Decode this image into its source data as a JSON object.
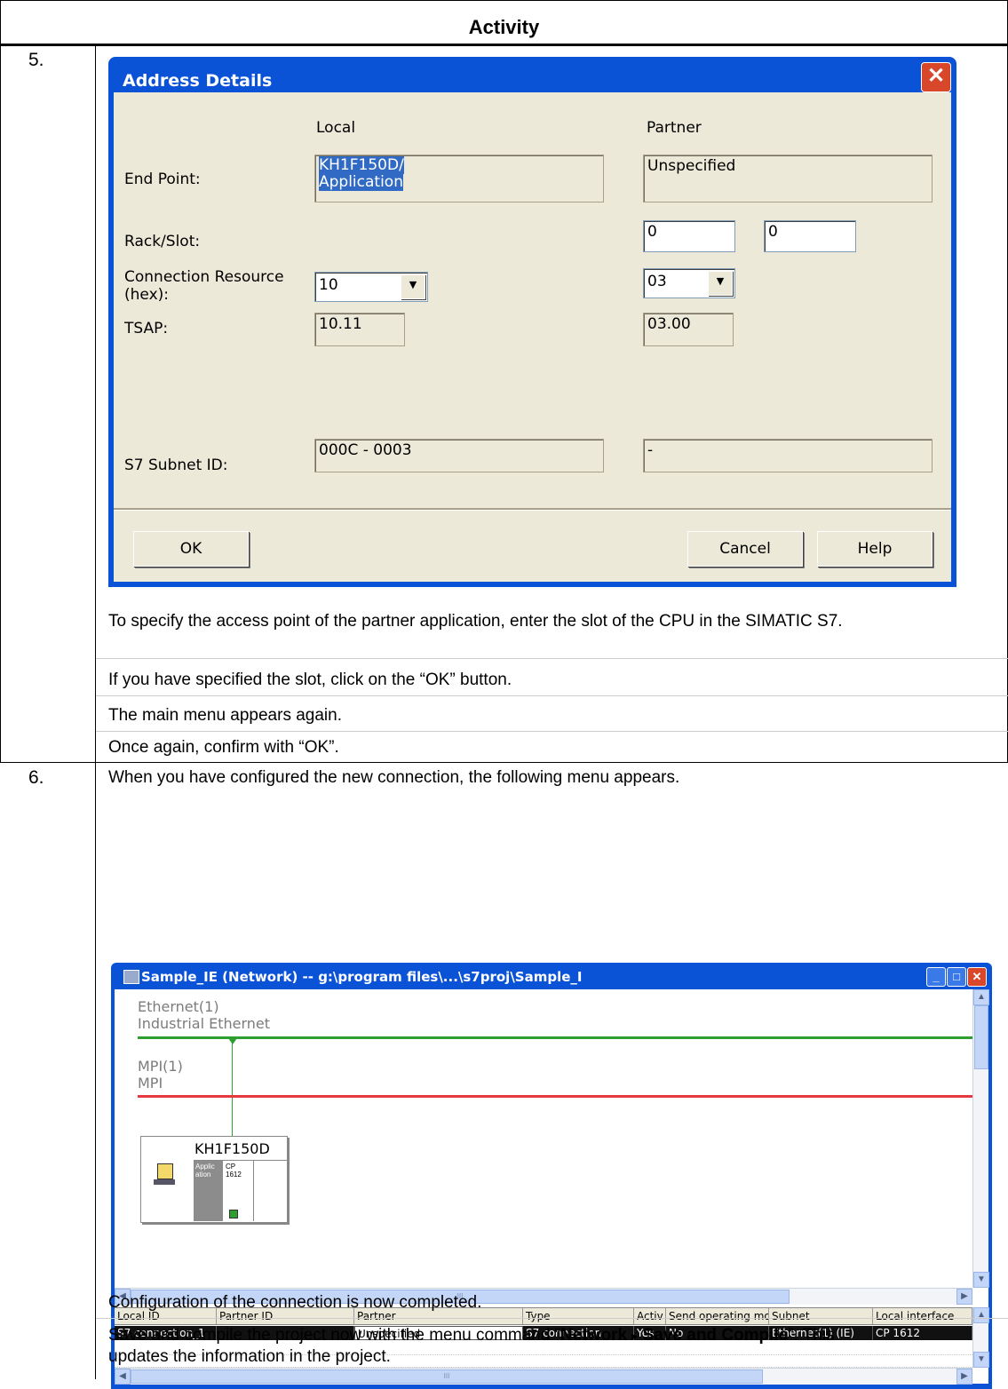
{
  "table": {
    "header": "Activity",
    "steps": [
      {
        "number": "5.",
        "paragraphs": [
          "To specify the access point of the partner application, enter the slot of the CPU in the SIMATIC S7.",
          "If you have specified the slot, click on the “OK” button.",
          "The main menu appears again.",
          "Once again, confirm with “OK”."
        ]
      },
      {
        "number": "6.",
        "intro": "When you have configured the new connection, the following menu appears.",
        "outro1": "Configuration of the connection is now completed.",
        "outro2_prefix": "Save and compile the project now with the menu command “",
        "outro2_bold1": "Network",
        "outro2_arrow": "▸",
        "outro2_bold2": "Save and Compile",
        "outro2_suffix": "”. This updates the information in the project."
      }
    ]
  },
  "dialog": {
    "title": "Address Details",
    "close_icon": "close-icon",
    "col_local": "Local",
    "col_partner": "Partner",
    "end_point_label": "End Point:",
    "end_point_local_line1": "KH1F150D/",
    "end_point_local_line2": "Application",
    "end_point_partner": "Unspecified",
    "rack_slot_label": "Rack/Slot:",
    "rack_value": "0",
    "slot_value": "0",
    "conn_res_label_line1": "Connection Resource",
    "conn_res_label_line2": "(hex):",
    "conn_res_local": "10",
    "conn_res_partner": "03",
    "tsap_label": "TSAP:",
    "tsap_local": "10.11",
    "tsap_partner": "03.00",
    "subnet_label": "S7 Subnet ID:",
    "subnet_local": "000C - 0003",
    "subnet_partner": "-",
    "ok_label": "OK",
    "cancel_label": "Cancel",
    "help_label": "Help"
  },
  "netwindow": {
    "title": "Sample_IE (Network) -- g:\\program files\\...\\s7proj\\Sample_I",
    "ethernet_name": "Ethernet(1)",
    "ethernet_type": "Industrial Ethernet",
    "mpi_name": "MPI(1)",
    "mpi_type": "MPI",
    "station_name": "KH1F150D",
    "slot1_line1": "Applic",
    "slot1_line2": "ation",
    "slot2_line1": "CP",
    "slot2_line2": "1612",
    "scroll_grip": "III",
    "colors": {
      "ethernet": "#2e9e2e",
      "mpi": "#e8383f"
    },
    "grid": {
      "headers": [
        "Local ID",
        "Partner ID",
        "Partner",
        "Type",
        "Activ",
        "Send operating mod",
        "Subnet",
        "Local interface"
      ],
      "row": [
        "S7 connection_1",
        "",
        "Unspecified",
        "S7 connection",
        "Yes",
        "No",
        "Ethernet(1) (IE)",
        "CP 1612"
      ]
    }
  }
}
